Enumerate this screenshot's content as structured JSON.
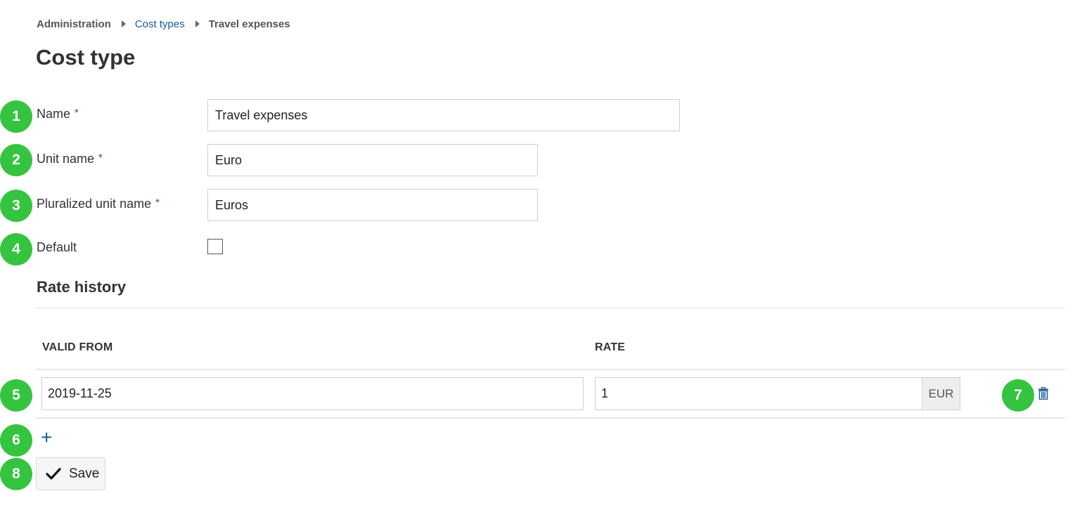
{
  "breadcrumb": {
    "items": [
      {
        "label": "Administration",
        "link": false
      },
      {
        "label": "Cost types",
        "link": true
      },
      {
        "label": "Travel expenses",
        "link": false
      }
    ]
  },
  "page": {
    "title": "Cost type"
  },
  "form": {
    "name": {
      "label": "Name",
      "required_mark": "*",
      "value": "Travel expenses"
    },
    "unit_name": {
      "label": "Unit name",
      "required_mark": "*",
      "value": "Euro"
    },
    "plural_unit_name": {
      "label": "Pluralized unit name",
      "required_mark": "*",
      "value": "Euros"
    },
    "default": {
      "label": "Default",
      "checked": false
    }
  },
  "rate_history": {
    "title": "Rate history",
    "columns": [
      "VALID FROM",
      "RATE"
    ],
    "rows": [
      {
        "valid_from": "2019-11-25",
        "rate": "1",
        "currency": "EUR"
      }
    ],
    "add_label": "+",
    "delete_icon": "trash-icon"
  },
  "actions": {
    "save_label": "Save",
    "save_icon": "checkmark-icon"
  },
  "annotations": {
    "badges": [
      "1",
      "2",
      "3",
      "4",
      "5",
      "6",
      "7",
      "8"
    ],
    "color": "#35c43f"
  }
}
